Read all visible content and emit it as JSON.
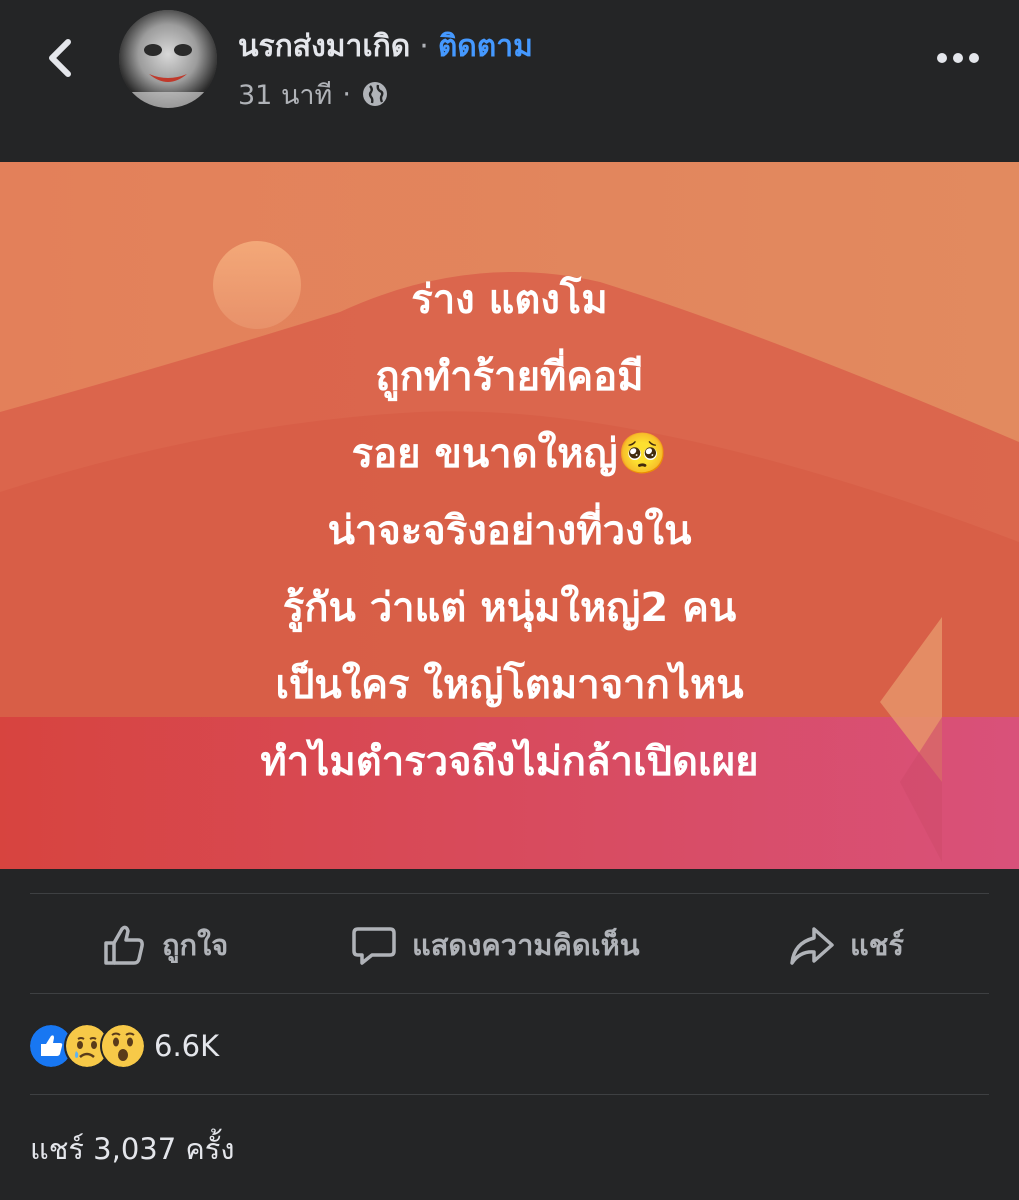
{
  "header": {
    "back_icon": "chevron-left-icon",
    "author_name": "นรกส่งมาเกิด",
    "separator": "·",
    "follow_label": "ติดตาม",
    "post_time": "31 นาที",
    "meta_separator": "·",
    "privacy_icon": "globe-icon",
    "more_icon": "more-horizontal-icon"
  },
  "post": {
    "lines": [
      "ร่าง แตงโม",
      "ถูกทำร้ายที่คอมี",
      "รอย ขนาดใหญ่🥺",
      "น่าจะจริงอย่างที่วงใน",
      "รู้กัน ว่าแต่ หนุ่มใหญ่2 คน",
      "เป็นใคร ใหญ่โตมาจากไหน",
      "ทำไมตำรวจถึงไม่กล้าเปิดเผย"
    ],
    "text_color": "#ffffff",
    "background_colors": [
      "#e07a55",
      "#d86045",
      "#d84a6a"
    ]
  },
  "actions": {
    "like_label": "ถูกใจ",
    "like_icon": "thumbs-up-icon",
    "comment_label": "แสดงความคิดเห็น",
    "comment_icon": "comment-icon",
    "share_label": "แชร์",
    "share_icon": "share-arrow-icon"
  },
  "reactions": {
    "icons": [
      "like-reaction-icon",
      "sad-reaction-icon",
      "wow-reaction-icon"
    ],
    "count": "6.6K"
  },
  "shares": {
    "text": "แชร์ 3,037 ครั้ง"
  },
  "colors": {
    "background": "#242526",
    "primary_text": "#e4e6eb",
    "secondary_text": "#b0b3b8",
    "link": "#4599ff",
    "like_blue": "#1877f2"
  }
}
